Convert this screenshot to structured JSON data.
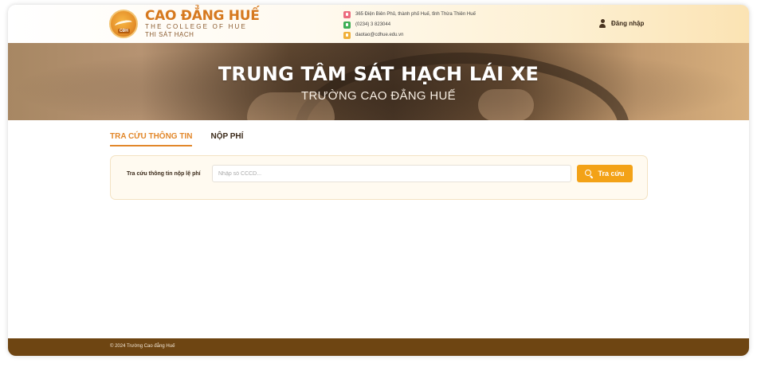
{
  "header": {
    "logo": {
      "title": "CAO ĐẲNG HUẾ",
      "subtitle": "THE COLLEGE OF HUE",
      "caption": "THI SÁT HẠCH",
      "emblem_text": "CĐH"
    },
    "contact": {
      "address": "365 Điện Biên Phủ, thành phố Huế, tỉnh Thừa Thiên Huế",
      "phone": "(0234) 3 823044",
      "email": "daotao@cdhue.edu.vn"
    },
    "login_label": "Đăng nhập"
  },
  "hero": {
    "title": "TRUNG TÂM SÁT HẠCH LÁI XE",
    "subtitle": "TRƯỜNG CAO ĐẲNG HUẾ"
  },
  "tabs": [
    {
      "label": "TRA CỨU THÔNG TIN",
      "active": true
    },
    {
      "label": "NỘP PHÍ",
      "active": false
    }
  ],
  "search": {
    "label": "Tra cứu thông tin nộp lệ phí",
    "value": "",
    "placeholder": "Nhập số CCCD...",
    "button_label": "Tra cứu"
  },
  "footer": {
    "text": "© 2024 Trường Cao đẳng Huế"
  },
  "colors": {
    "accent": "#e2872a",
    "button": "#f3a217",
    "footer": "#6e4512",
    "address_icon": "#ec6b7e",
    "phone_icon": "#3fae55",
    "email_icon": "#f0b03a"
  }
}
